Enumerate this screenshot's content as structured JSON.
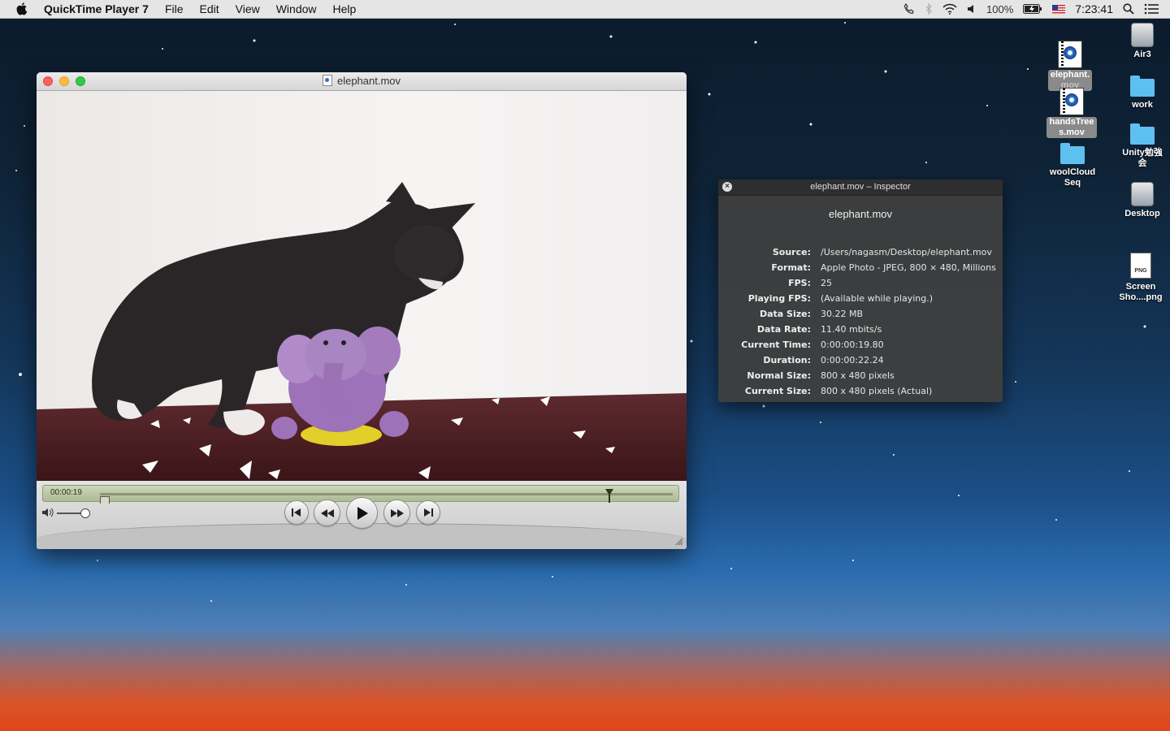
{
  "menubar": {
    "app_name": "QuickTime Player 7",
    "menus": [
      "File",
      "Edit",
      "View",
      "Window",
      "Help"
    ],
    "battery": "100%",
    "clock": "7:23:41"
  },
  "player": {
    "title": "elephant.mov",
    "timecode": "00:00:19",
    "playhead_fraction": 0.89,
    "volume_fraction": 0.9
  },
  "inspector": {
    "title": "elephant.mov – Inspector",
    "file_name": "elephant.mov",
    "rows": [
      {
        "label": "Source:",
        "value": "/Users/nagasm/Desktop/elephant.mov"
      },
      {
        "label": "Format:",
        "value": "Apple Photo - JPEG, 800 × 480, Millions"
      },
      {
        "label": "FPS:",
        "value": "25"
      },
      {
        "label": "Playing FPS:",
        "value": "(Available while playing.)"
      },
      {
        "label": "Data Size:",
        "value": "30.22 MB"
      },
      {
        "label": "Data Rate:",
        "value": "11.40 mbits/s"
      },
      {
        "label": "Current Time:",
        "value": "0:00:00:19.80"
      },
      {
        "label": "Duration:",
        "value": "0:00:00:22.24"
      },
      {
        "label": "Normal Size:",
        "value": "800 x 480 pixels"
      },
      {
        "label": "Current Size:",
        "value": "800 x 480 pixels (Actual)"
      }
    ]
  },
  "desktop": {
    "icons": [
      {
        "label": "elephant.mov",
        "kind": "movie-file-icon",
        "selected": true
      },
      {
        "label": "handsTrees.mov",
        "kind": "movie-file-icon",
        "selected": true
      },
      {
        "label": "woolCloudSeq",
        "kind": "folder-icon"
      },
      {
        "label": "Air3",
        "kind": "drive-icon"
      },
      {
        "label": "work",
        "kind": "folder-icon"
      },
      {
        "label": "Unity勉強会",
        "kind": "folder-icon"
      },
      {
        "label": "Desktop",
        "kind": "drive-icon"
      },
      {
        "label": "Screen Sho....png",
        "kind": "png-file-icon"
      }
    ],
    "label_lines": {
      "elephant": [
        "elephant.",
        "mov"
      ],
      "handsTrees": [
        "handsTree",
        "s.mov"
      ],
      "woolCloud": [
        "woolCloud",
        "Seq"
      ],
      "air3": [
        "Air3"
      ],
      "work": [
        "work"
      ],
      "unity": [
        "Unity勉強",
        "会"
      ],
      "desktop": [
        "Desktop"
      ],
      "screenshot": [
        "Screen",
        "Sho....png"
      ],
      "png_tag": "PNG"
    }
  },
  "colors": {
    "accent_green_scrubber": "#aebb93",
    "close_red": "#fc605c",
    "minimize_yellow": "#fdbc40",
    "zoom_green": "#34c84a",
    "folder_blue": "#5ec0ef"
  }
}
